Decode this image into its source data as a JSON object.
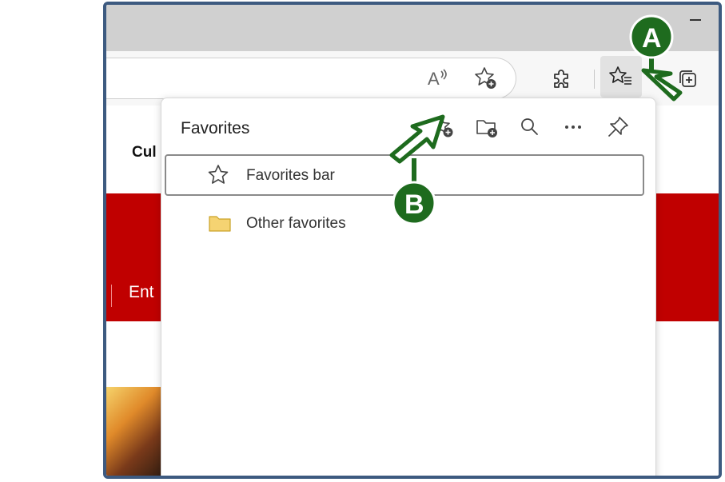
{
  "browser": {
    "toolbar": {
      "read_aloud_label": "A",
      "read_aloud_icon": "read-aloud-icon",
      "add_favorite_icon": "star-add-icon",
      "extensions_icon": "puzzle-icon",
      "favorites_icon": "star-list-icon",
      "collections_icon": "collections-icon"
    }
  },
  "page": {
    "partial_text_1": "Cul",
    "partial_text_2": "Ent",
    "accent_color": "#c00000"
  },
  "favorites_panel": {
    "title": "Favorites",
    "actions": [
      "add-favorite-icon",
      "add-folder-icon",
      "search-icon",
      "more-icon",
      "pin-icon"
    ],
    "more_label": "···",
    "items": [
      {
        "label": "Favorites bar",
        "icon": "star-icon"
      },
      {
        "label": "Other favorites",
        "icon": "folder-icon"
      }
    ]
  },
  "callouts": {
    "a_label": "A",
    "b_label": "B",
    "color": "#1e6b1e"
  }
}
